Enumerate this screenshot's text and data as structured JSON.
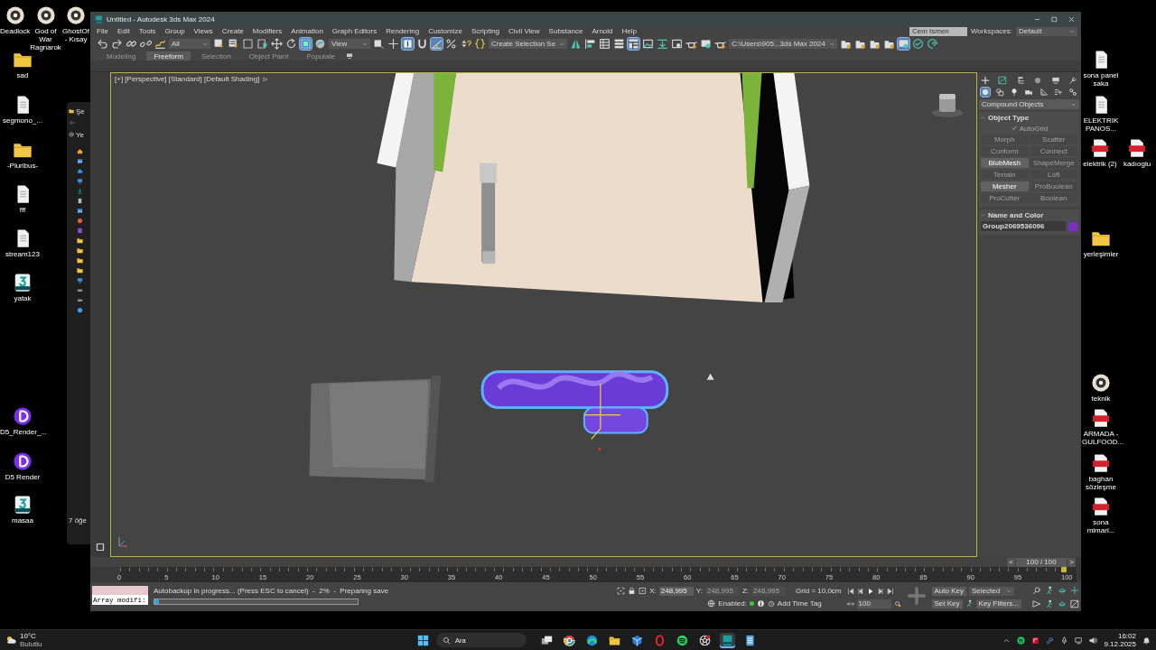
{
  "desktop_icons": [
    {
      "kind": "app",
      "label": "Deadlock"
    },
    {
      "kind": "app",
      "label": "God of War Ragnarok"
    },
    {
      "kind": "app",
      "label": "GhostOf - Kısay"
    },
    {
      "kind": "folder",
      "label": "sad"
    },
    {
      "kind": "file",
      "label": "segmono_..."
    },
    {
      "kind": "folder",
      "label": "-Pluribus-"
    },
    {
      "kind": "file",
      "label": "fff"
    },
    {
      "kind": "file",
      "label": "stream123"
    },
    {
      "kind": "max",
      "label": "yatak"
    },
    {
      "kind": "d5",
      "label": "D5_Render_..."
    },
    {
      "kind": "d5",
      "label": "D5 Render"
    },
    {
      "kind": "max",
      "label": "masaa"
    },
    {
      "kind": "file",
      "label": "sona panel saka"
    },
    {
      "kind": "file",
      "label": "ELEKTRIK PANOS..."
    },
    {
      "kind": "pdf",
      "label": "elektrik (2)"
    },
    {
      "kind": "pdf",
      "label": "kadıoglu"
    },
    {
      "kind": "folder",
      "label": "yerleşimler"
    },
    {
      "kind": "app",
      "label": "teknik"
    },
    {
      "kind": "pdf",
      "label": "ARMADA - GULFOOD..."
    },
    {
      "kind": "pdf",
      "label": "baghan sözleşme"
    },
    {
      "kind": "pdf",
      "label": "sona mimari..."
    }
  ],
  "explorer": {
    "title": "Şe",
    "new_button": "Ye",
    "status": "7 öğe"
  },
  "window": {
    "title": "Untitled - Autodesk 3ds Max 2024",
    "user": "Cem Ismen",
    "workspaces_label": "Workspaces:",
    "workspace": "Default"
  },
  "menu": [
    "File",
    "Edit",
    "Tools",
    "Group",
    "Views",
    "Create",
    "Modifiers",
    "Animation",
    "Graph Editors",
    "Rendering",
    "Customize",
    "Scripting",
    "Civil View",
    "Substance",
    "Arnold",
    "Help"
  ],
  "toolbar": [
    {
      "kind": "undo",
      "selected": false
    },
    {
      "kind": "redo",
      "selected": false
    },
    {
      "kind": "chain",
      "selected": false
    },
    {
      "kind": "broken-chain",
      "selected": false
    },
    {
      "kind": "squiggle",
      "selected": false
    },
    {
      "kind": "dropdown",
      "value": "All"
    },
    {
      "kind": "cursor-box",
      "selected": false
    },
    {
      "kind": "list-cursor",
      "selected": false
    },
    {
      "kind": "dashed-square",
      "selected": false
    },
    {
      "kind": "dashed-square-dot",
      "selected": false
    },
    {
      "kind": "move-arrows",
      "selected": false
    },
    {
      "kind": "rotate-arrow",
      "selected": false
    },
    {
      "kind": "scale-square",
      "selected": true
    },
    {
      "kind": "sphere",
      "selected": false
    },
    {
      "kind": "dropdown",
      "value": "View"
    },
    {
      "kind": "pivot-box",
      "selected": false
    },
    {
      "kind": "crosshair",
      "selected": false
    },
    {
      "kind": "hand-box",
      "selected": true
    },
    {
      "kind": "magnet",
      "selected": false
    },
    {
      "kind": "angle",
      "selected": true
    },
    {
      "kind": "percent",
      "selected": false
    },
    {
      "kind": "spinner",
      "selected": false
    },
    {
      "kind": "braces",
      "selected": false
    },
    {
      "kind": "dropdown",
      "value": "Create Selection Se"
    },
    {
      "kind": "mirror",
      "selected": false
    },
    {
      "kind": "align",
      "selected": false
    },
    {
      "kind": "table",
      "selected": false
    },
    {
      "kind": "layers",
      "selected": false
    },
    {
      "kind": "grid-list",
      "selected": true
    },
    {
      "kind": "image-box",
      "selected": false
    },
    {
      "kind": "download",
      "selected": false
    },
    {
      "kind": "panel",
      "selected": false
    },
    {
      "kind": "teapot",
      "selected": false
    },
    {
      "kind": "render-frame",
      "selected": false
    },
    {
      "kind": "teapot",
      "selected": false
    },
    {
      "kind": "dropdown",
      "value": "C:\\Users\\905...3ds Max 2024"
    },
    {
      "kind": "folder-star",
      "selected": false
    },
    {
      "kind": "folder-star",
      "selected": false
    },
    {
      "kind": "folder-star",
      "selected": false
    },
    {
      "kind": "folder-star",
      "selected": false
    },
    {
      "kind": "render-frame",
      "selected": true
    },
    {
      "kind": "check-circle",
      "selected": false
    },
    {
      "kind": "spiral",
      "selected": false
    }
  ],
  "ribbon_tabs": [
    {
      "label": "Modeling",
      "selected": false
    },
    {
      "label": "Freeform",
      "selected": true
    },
    {
      "label": "Selection",
      "selected": false
    },
    {
      "label": "Object Paint",
      "selected": false
    },
    {
      "label": "Populate",
      "selected": false
    }
  ],
  "viewport": {
    "label": "[+] [Perspective] [Standard] [Default Shading]"
  },
  "command_panel": {
    "tabs": [
      {
        "kind": "plus",
        "selected": false
      },
      {
        "kind": "curve-box",
        "selected": false
      },
      {
        "kind": "hierarchy",
        "selected": false
      },
      {
        "kind": "ball",
        "selected": false
      },
      {
        "kind": "monitor",
        "selected": false
      },
      {
        "kind": "wrench",
        "selected": false
      }
    ],
    "categories": [
      {
        "kind": "circle",
        "selected": true
      },
      {
        "kind": "shapes",
        "selected": false
      },
      {
        "kind": "bulb",
        "selected": false
      },
      {
        "kind": "camera",
        "selected": false
      },
      {
        "kind": "ruler",
        "selected": false
      },
      {
        "kind": "waves",
        "selected": false
      },
      {
        "kind": "links",
        "selected": false
      }
    ],
    "dropdown": "Compound Objects",
    "object_type": {
      "title": "Object Type",
      "autogrid": {
        "label": "AutoGrid",
        "checked": true,
        "disabled": true
      },
      "buttons": [
        {
          "label": "Morph",
          "disabled": true
        },
        {
          "label": "Scatter",
          "disabled": true
        },
        {
          "label": "Conform",
          "disabled": true
        },
        {
          "label": "Connect",
          "disabled": true
        },
        {
          "label": "BlobMesh",
          "disabled": false
        },
        {
          "label": "ShapeMerge",
          "disabled": true
        },
        {
          "label": "Terrain",
          "disabled": true
        },
        {
          "label": "Loft",
          "disabled": true
        },
        {
          "label": "Mesher",
          "disabled": false
        },
        {
          "label": "ProBoolean",
          "disabled": true
        },
        {
          "label": "ProCutter",
          "disabled": true
        },
        {
          "label": "Boolean",
          "disabled": true
        }
      ]
    },
    "name_and_color": {
      "title": "Name and Color",
      "name": "Group2069536096",
      "color": "#7a2fc0"
    }
  },
  "time_slider": {
    "prev": "<",
    "label": "100 / 100",
    "next": ">",
    "level": 1
  },
  "track_bar": {
    "ticks": [
      "0",
      "5",
      "10",
      "15",
      "20",
      "25",
      "30",
      "35",
      "40",
      "45",
      "50",
      "55",
      "60",
      "65",
      "70",
      "75",
      "80",
      "85",
      "90",
      "95",
      "100"
    ]
  },
  "status": {
    "listener": "Array modifi:",
    "message": "Autobackup in progress... (Press ESC to cancel)  -  2%  -  Preparing save",
    "level": 0.02,
    "coords": [
      {
        "axis": "X:",
        "value": "248,995",
        "disabled": false
      },
      {
        "axis": "Y:",
        "value": "248,995",
        "disabled": true
      },
      {
        "axis": "Z:",
        "value": "248,995",
        "disabled": true
      }
    ],
    "grid": "Grid = 10,0cm",
    "enabled_label": "Enabled:",
    "time_tag": "Add Time Tag",
    "frame": "100",
    "auto_key": "Auto Key",
    "key_mode": "Selected",
    "set_key": "Set Key",
    "key_filters": "Key Filters..."
  },
  "taskbar": {
    "temperature": "10°C",
    "weather": "Bulutlu",
    "search": "Ara",
    "apps": [
      {
        "kind": "task-view",
        "selected": false
      },
      {
        "kind": "globe",
        "selected": false
      },
      {
        "kind": "swirl",
        "selected": false
      },
      {
        "kind": "folder",
        "selected": false
      },
      {
        "kind": "cube",
        "selected": false
      },
      {
        "kind": "ring",
        "selected": false
      },
      {
        "kind": "striped-ball",
        "selected": false
      },
      {
        "kind": "aperture",
        "selected": false
      },
      {
        "kind": "max",
        "selected": true
      },
      {
        "kind": "notepad",
        "selected": false
      }
    ],
    "time": "16:02",
    "date": "9.12.2025"
  }
}
